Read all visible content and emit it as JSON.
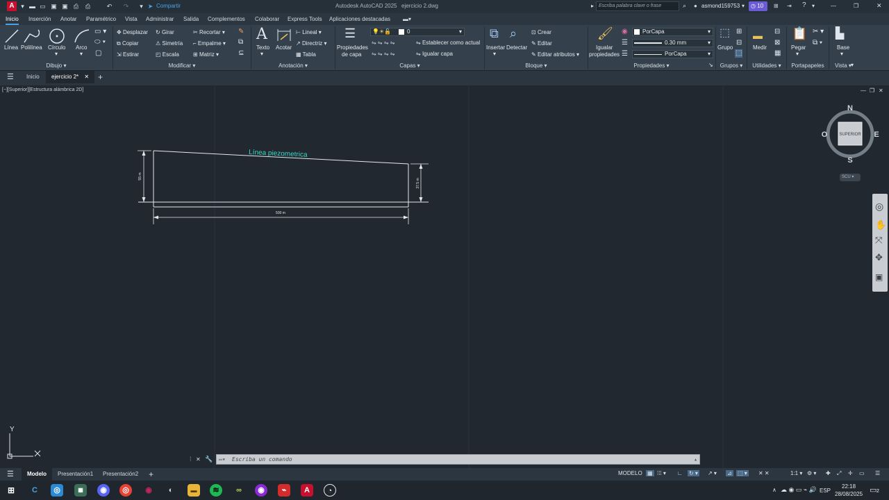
{
  "titlebar": {
    "app_title": "Autodesk AutoCAD 2025",
    "file_name": "ejercicio 2.dwg",
    "share_label": "Compartir",
    "search_placeholder": "Escriba palabra clave o frase",
    "user": "asmond159753",
    "notifications": "10",
    "app_letter": "A"
  },
  "menu": [
    "Inicio",
    "Inserción",
    "Anotar",
    "Paramétrico",
    "Vista",
    "Administrar",
    "Salida",
    "Complementos",
    "Colaborar",
    "Express Tools",
    "Aplicaciones destacadas"
  ],
  "ribbon": {
    "dibujo": {
      "linea": "Línea",
      "polilinea": "Polilínea",
      "circulo": "Círculo",
      "arco": "Arco",
      "group": "Dibujo"
    },
    "modificar": {
      "desplazar": "Desplazar",
      "girar": "Girar",
      "recortar": "Recortar",
      "copiar": "Copiar",
      "simetria": "Simetría",
      "empalme": "Empalme",
      "estirar": "Estirar",
      "escala": "Escala",
      "matriz": "Matriz",
      "group": "Modificar"
    },
    "anotacion": {
      "texto": "Texto",
      "acotar": "Acotar",
      "lineal": "Lineal",
      "directriz": "Directriz",
      "tabla": "Tabla",
      "group": "Anotación"
    },
    "capas": {
      "propiedades_l1": "Propiedades",
      "propiedades_l2": "de capa",
      "layer_value": "0",
      "establecer": "Establecer como actual",
      "igualar": "Igualar capa",
      "group": "Capas"
    },
    "bloque": {
      "insertar": "Insertar",
      "detectar": "Detectar",
      "crear": "Crear",
      "editar": "Editar",
      "editar_atributos": "Editar atributos",
      "group": "Bloque"
    },
    "propiedades": {
      "igualar_l1": "Igualar",
      "igualar_l2": "propiedades",
      "color": "PorCapa",
      "lineweight": "0.30 mm",
      "linetype": "PorCapa",
      "group": "Propiedades"
    },
    "grupos": {
      "grupo": "Grupo",
      "group": "Grupos"
    },
    "utilidades": {
      "medir": "Medir",
      "group": "Utilidades"
    },
    "portapapeles": {
      "pegar": "Pegar",
      "group": "Portapapeles"
    },
    "vista": {
      "base": "Base",
      "group": "Vista"
    }
  },
  "doctabs": {
    "inicio": "Inicio",
    "active": "ejercicio 2*"
  },
  "viewport": {
    "label": "[−][Superior][Estructura alámbrica 2D]",
    "viewcube": {
      "n": "N",
      "s": "S",
      "e": "E",
      "o": "O",
      "face": "SUPERIOR",
      "ucs": "SCU"
    },
    "axis_y": "Y"
  },
  "drawing": {
    "annotation": "Línea piezometrica",
    "dim_left": "55 m",
    "dim_right": "37.5 m",
    "dim_bottom": "500 m",
    "colors": {
      "annotation": "#3fd6c4",
      "lines": "#e6e9ec"
    }
  },
  "command": {
    "placeholder": "Escriba un comando"
  },
  "layouts": {
    "model": "Modelo",
    "p1": "Presentación1",
    "p2": "Presentación2"
  },
  "status": {
    "mode": "MODELO",
    "scale": "1:1"
  },
  "taskbar": {
    "lang": "ESP",
    "time": "22:18",
    "date": "28/08/2025",
    "badge": "2"
  }
}
